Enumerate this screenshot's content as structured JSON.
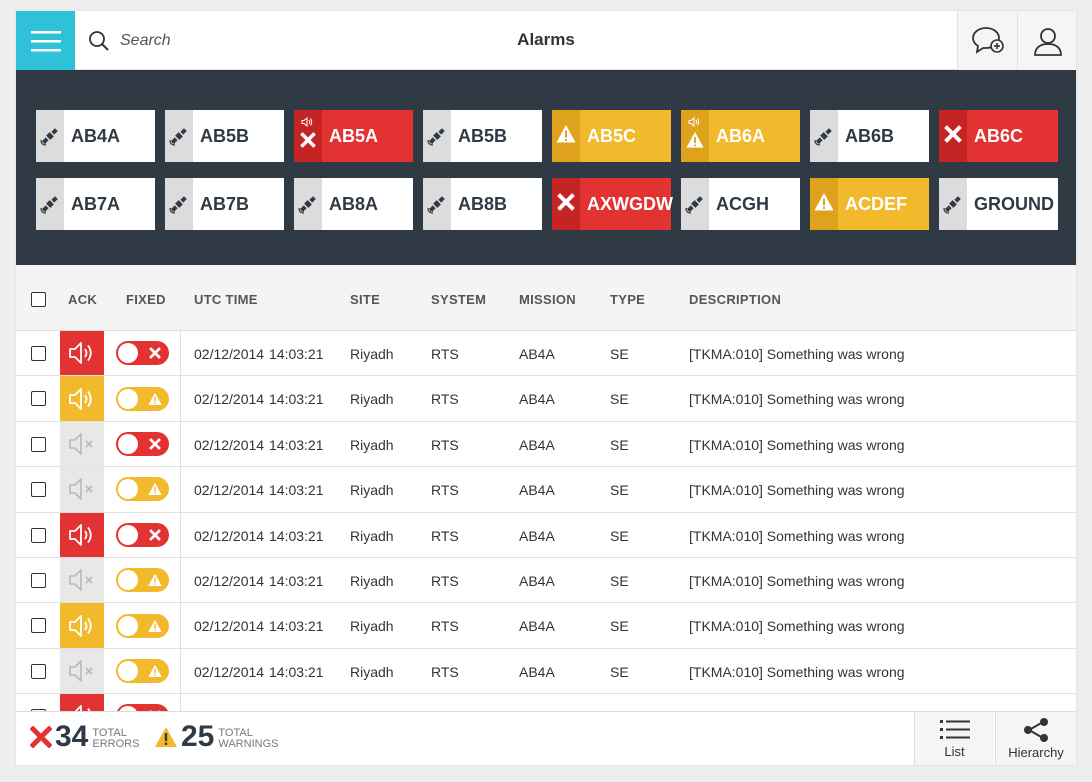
{
  "header": {
    "title": "Alarms",
    "search_placeholder": "Search",
    "menu_icon": "hamburger-icon",
    "chat_icon": "chat-add-icon",
    "user_icon": "user-icon"
  },
  "colors": {
    "accent": "#2fc1d8",
    "error": "#e23232",
    "warning": "#f3b92d",
    "panel": "#303a45"
  },
  "tiles": [
    {
      "label": "AB4A",
      "status": "normal"
    },
    {
      "label": "AB5B",
      "status": "normal"
    },
    {
      "label": "AB5A",
      "status": "error",
      "sound": true
    },
    {
      "label": "AB5B",
      "status": "normal"
    },
    {
      "label": "AB5C",
      "status": "warning"
    },
    {
      "label": "AB6A",
      "status": "warning",
      "sound": true
    },
    {
      "label": "AB6B",
      "status": "normal"
    },
    {
      "label": "AB6C",
      "status": "error"
    },
    {
      "label": "AB7A",
      "status": "normal"
    },
    {
      "label": "AB7B",
      "status": "normal"
    },
    {
      "label": "AB8A",
      "status": "normal"
    },
    {
      "label": "AB8B",
      "status": "normal"
    },
    {
      "label": "AXWGDW",
      "status": "error"
    },
    {
      "label": "ACGH",
      "status": "normal"
    },
    {
      "label": "ACDEF",
      "status": "warning"
    },
    {
      "label": "GROUND",
      "status": "normal"
    }
  ],
  "table": {
    "columns": {
      "ack": "ACK",
      "fixed": "FIXED",
      "utc_time": "UTC TIME",
      "site": "SITE",
      "system": "SYSTEM",
      "mission": "MISSION",
      "type": "TYPE",
      "description": "DESCRIPTION"
    },
    "rows": [
      {
        "ack": "error",
        "fixed": "error",
        "date": "02/12/2014",
        "time": "14:03:21",
        "site": "Riyadh",
        "system": "RTS",
        "mission": "AB4A",
        "type": "SE",
        "description": "[TKMA:010] Something was wrong"
      },
      {
        "ack": "warning",
        "fixed": "warning",
        "date": "02/12/2014",
        "time": "14:03:21",
        "site": "Riyadh",
        "system": "RTS",
        "mission": "AB4A",
        "type": "SE",
        "description": "[TKMA:010] Something was wrong"
      },
      {
        "ack": "muted",
        "fixed": "error",
        "date": "02/12/2014",
        "time": "14:03:21",
        "site": "Riyadh",
        "system": "RTS",
        "mission": "AB4A",
        "type": "SE",
        "description": "[TKMA:010] Something was wrong"
      },
      {
        "ack": "muted",
        "fixed": "warning",
        "date": "02/12/2014",
        "time": "14:03:21",
        "site": "Riyadh",
        "system": "RTS",
        "mission": "AB4A",
        "type": "SE",
        "description": "[TKMA:010] Something was wrong"
      },
      {
        "ack": "error",
        "fixed": "error",
        "date": "02/12/2014",
        "time": "14:03:21",
        "site": "Riyadh",
        "system": "RTS",
        "mission": "AB4A",
        "type": "SE",
        "description": "[TKMA:010] Something was wrong"
      },
      {
        "ack": "muted",
        "fixed": "warning",
        "date": "02/12/2014",
        "time": "14:03:21",
        "site": "Riyadh",
        "system": "RTS",
        "mission": "AB4A",
        "type": "SE",
        "description": "[TKMA:010] Something was wrong"
      },
      {
        "ack": "warning",
        "fixed": "warning",
        "date": "02/12/2014",
        "time": "14:03:21",
        "site": "Riyadh",
        "system": "RTS",
        "mission": "AB4A",
        "type": "SE",
        "description": "[TKMA:010] Something was wrong"
      },
      {
        "ack": "muted",
        "fixed": "warning",
        "date": "02/12/2014",
        "time": "14:03:21",
        "site": "Riyadh",
        "system": "RTS",
        "mission": "AB4A",
        "type": "SE",
        "description": "[TKMA:010] Something was wrong"
      },
      {
        "ack": "error",
        "fixed": "error",
        "date": "",
        "time": "",
        "site": "",
        "system": "",
        "mission": "",
        "type": "",
        "description": ""
      }
    ]
  },
  "footer": {
    "errors": {
      "count": "34",
      "caption_1": "TOTAL",
      "caption_2": "ERRORS",
      "icon": "error-x-icon"
    },
    "warnings": {
      "count": "25",
      "caption_1": "TOTAL",
      "caption_2": "WARNINGS",
      "icon": "warning-triangle-icon"
    },
    "list_label": "List",
    "hierarchy_label": "Hierarchy"
  }
}
